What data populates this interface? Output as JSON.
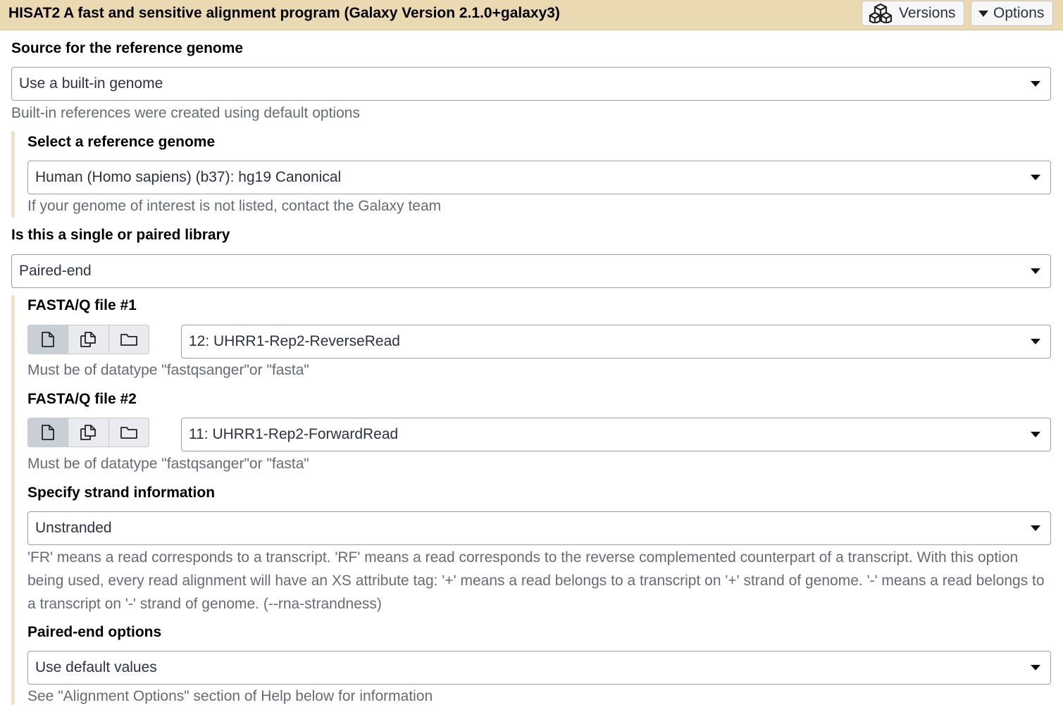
{
  "header": {
    "title": "HISAT2 A fast and sensitive alignment program (Galaxy Version 2.1.0+galaxy3)",
    "versions_label": "Versions",
    "options_label": "Options"
  },
  "reference_source": {
    "label": "Source for the reference genome",
    "value": "Use a built-in genome",
    "help": "Built-in references were created using default options"
  },
  "reference_genome": {
    "label": "Select a reference genome",
    "value": "Human (Homo sapiens) (b37): hg19 Canonical",
    "help": "If your genome of interest is not listed, contact the Galaxy team"
  },
  "library": {
    "label": "Is this a single or paired library",
    "value": "Paired-end"
  },
  "file1": {
    "label": "FASTA/Q file #1",
    "value": "12: UHRR1-Rep2-ReverseRead",
    "help": "Must be of datatype \"fastqsanger\"or \"fasta\""
  },
  "file2": {
    "label": "FASTA/Q file #2",
    "value": "11: UHRR1-Rep2-ForwardRead",
    "help": "Must be of datatype \"fastqsanger\"or \"fasta\""
  },
  "strand": {
    "label": "Specify strand information",
    "value": "Unstranded",
    "help": "'FR' means a read corresponds to a transcript. 'RF' means a read corresponds to the reverse complemented counterpart of a transcript. With this option being used, every read alignment will have an XS attribute tag: '+' means a read belongs to a transcript on '+' strand of genome. '-' means a read belongs to a transcript on '-' strand of genome. (--rna-strandness)"
  },
  "paired_options": {
    "label": "Paired-end options",
    "value": "Use default values",
    "help": "See \"Alignment Options\" section of Help below for information"
  },
  "icons": {
    "versions": "cubes-icon",
    "options": "caret-down-icon",
    "single_dataset": "file-icon",
    "multiple_datasets": "files-icon",
    "collection": "folder-icon"
  }
}
